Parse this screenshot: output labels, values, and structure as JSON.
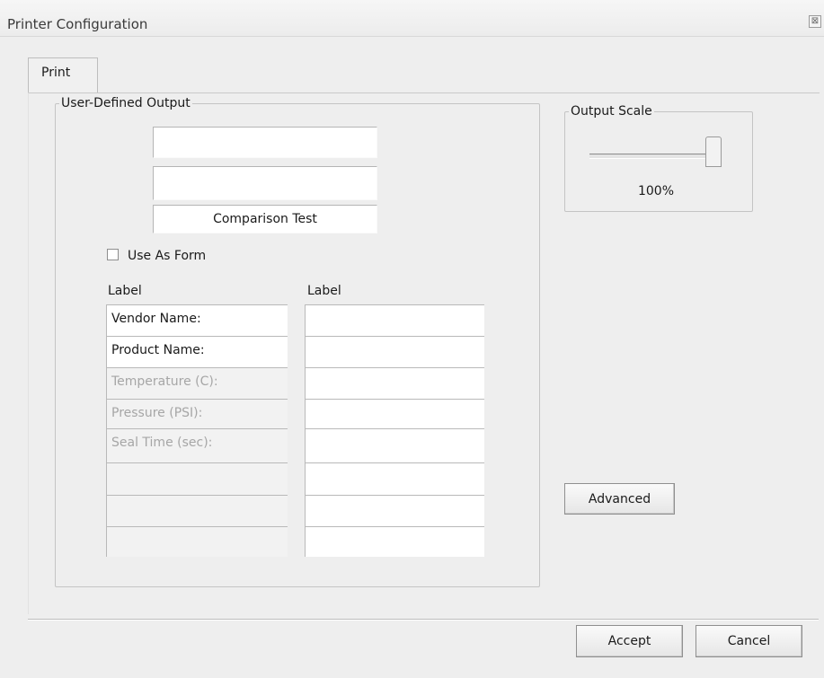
{
  "window": {
    "title": "Printer Configuration",
    "close_glyph": "⊠"
  },
  "tabs": [
    {
      "label": "Print"
    }
  ],
  "user_defined_output": {
    "legend": "User-Defined Output",
    "text_fields": [
      "",
      "",
      "Comparison Test"
    ],
    "use_as_form": {
      "label": "Use As Form",
      "checked": false
    },
    "column_headers": [
      "Label",
      "Label"
    ],
    "rows": [
      {
        "left": "Vendor Name:",
        "right": "",
        "enabled": true
      },
      {
        "left": "Product Name:",
        "right": "",
        "enabled": true
      },
      {
        "left": "Temperature (C):",
        "right": "",
        "enabled": false
      },
      {
        "left": "Pressure (PSI):",
        "right": "",
        "enabled": false
      },
      {
        "left": "Seal Time (sec):",
        "right": "",
        "enabled": false
      },
      {
        "left": "",
        "right": "",
        "enabled": false
      },
      {
        "left": "",
        "right": "",
        "enabled": false
      },
      {
        "left": "",
        "right": "",
        "enabled": false
      }
    ]
  },
  "output_scale": {
    "legend": "Output Scale",
    "value_label": "100%",
    "slider_fraction": 1.0
  },
  "buttons": {
    "advanced": "Advanced",
    "accept": "Accept",
    "cancel": "Cancel"
  }
}
